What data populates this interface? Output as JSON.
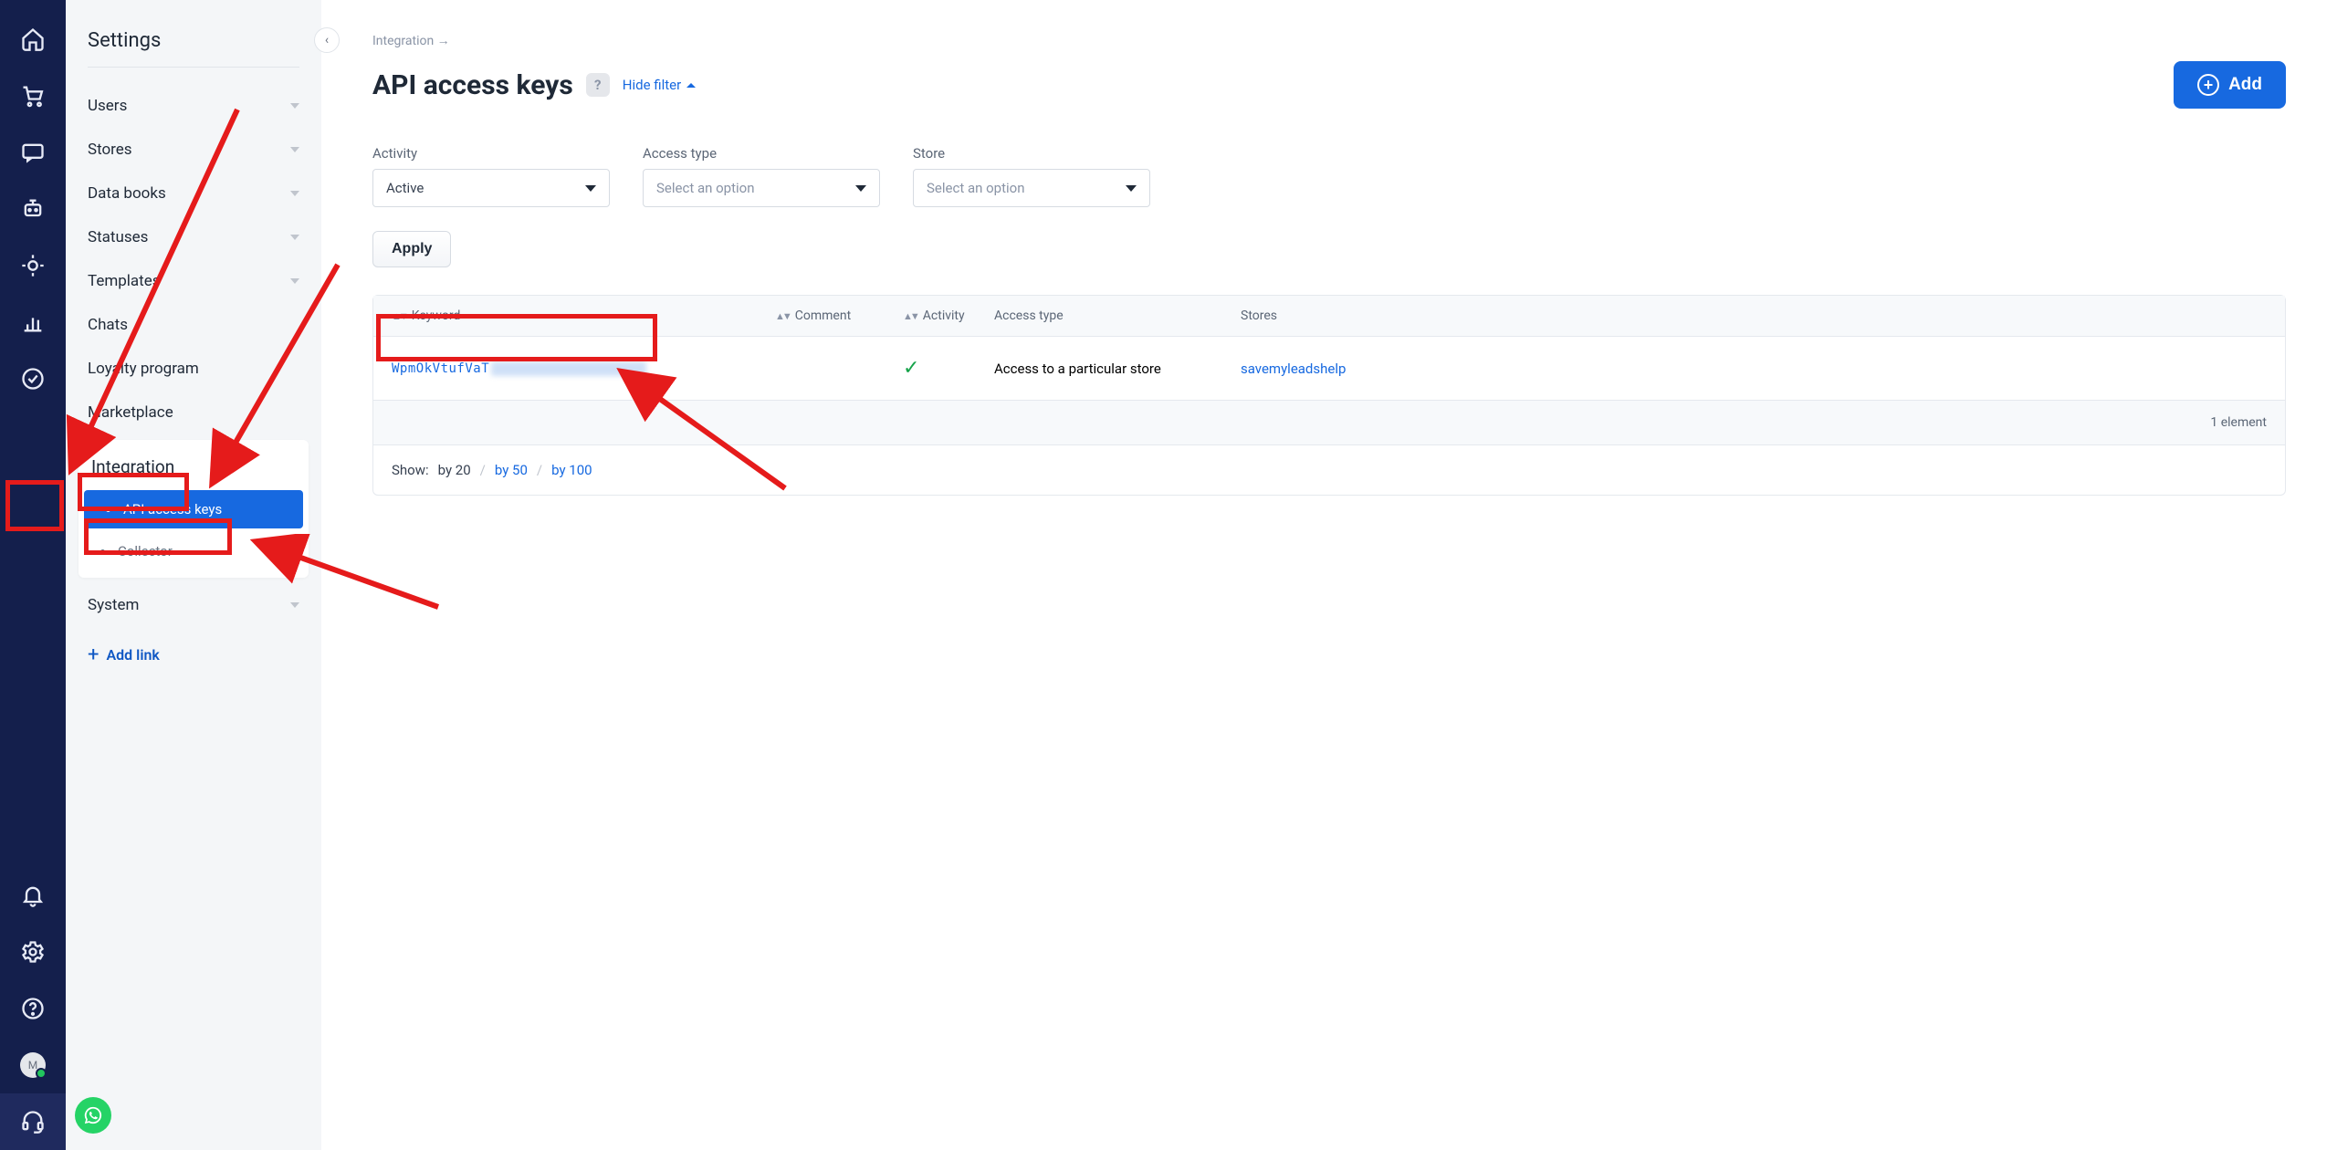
{
  "rail": {
    "avatar_initial": "M"
  },
  "sidebar": {
    "title": "Settings",
    "items": [
      {
        "label": "Users"
      },
      {
        "label": "Stores"
      },
      {
        "label": "Data books"
      },
      {
        "label": "Statuses"
      },
      {
        "label": "Templates"
      },
      {
        "label": "Chats"
      },
      {
        "label": "Loyalty program"
      },
      {
        "label": "Marketplace"
      }
    ],
    "integration": {
      "label": "Integration",
      "sub": [
        {
          "label": "API access keys"
        },
        {
          "label": "Collector"
        }
      ]
    },
    "system": {
      "label": "System"
    },
    "add_link": "Add link"
  },
  "main": {
    "breadcrumb": "Integration →",
    "title": "API access keys",
    "hide_filter": "Hide filter",
    "add_button": "Add",
    "filters": {
      "activity": {
        "label": "Activity",
        "value": "Active"
      },
      "access_type": {
        "label": "Access type",
        "placeholder": "Select an option"
      },
      "store": {
        "label": "Store",
        "placeholder": "Select an option"
      }
    },
    "apply": "Apply",
    "table": {
      "headers": {
        "keyword": "Keyword",
        "comment": "Comment",
        "activity": "Activity",
        "access_type": "Access type",
        "stores": "Stores"
      },
      "row": {
        "keyword_prefix": "WpmOkVtufVaT",
        "access_type": "Access to a particular store",
        "store": "savemyleadshelp"
      },
      "footer": "1 element"
    },
    "pagination": {
      "label": "Show:",
      "by20": "by 20",
      "by50": "by 50",
      "by100": "by 100"
    }
  }
}
